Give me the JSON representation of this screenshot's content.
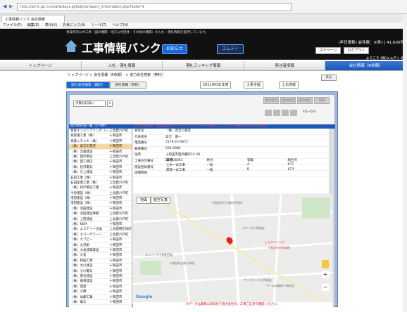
{
  "browser": {
    "url": "http://ad.fc.jp/ a.smartedays.jp/koji/company_information.php?data=1",
    "tab_title": "工事情報バンク 会社検索",
    "menu": [
      "ファイル(F)",
      "編集(E)",
      "表示(V)",
      "お気に入り(A)",
      "ツール(T)",
      "ヘルプ(H)"
    ]
  },
  "header": {
    "notice": "青森県内公共工事（国の機関・地方公共団体・その他の機関）の入札・落札情報を提供しています。",
    "logo": "工事情報バンク",
    "news_button": "お知らせ",
    "edy_button": "エムディ",
    "credit": "(年日更新) 会件数：(0件) | 41,605件",
    "mypage_button": "マイページ",
    "logout_button": "ログアウト",
    "welcome": "ようこそ (株)エムディ 様"
  },
  "nav": {
    "items": [
      "トップページ",
      "入札・落札情報",
      "落札ランキング情報",
      "発注者情報",
      "会社情報（R依頼）"
    ]
  },
  "breadcrumb": "トップページ > 会社情報（R依頼） > 協力会社検索（無料）",
  "subtabs": [
    "協力会社検索（無料）",
    "会社情報（有料）"
  ],
  "filters": {
    "year": "2021(R03)年度",
    "category": "工事全般",
    "region": "上北地域",
    "back": "戻る"
  },
  "list_panel": {
    "sort": "点数対応高い",
    "header": "協力会社名一覧（279件）",
    "buttons": [
      "協力会社",
      "協力会社",
      "協力会社",
      "印刷"
    ],
    "page_text": "4/1~5/4",
    "rows": [
      {
        "name": "青森エンジニアリング（一",
        "area": "上北郡六戸町"
      },
      {
        "name": "青森電工業（株）",
        "area": "十和田市"
      },
      {
        "name": "青森ニチレキ（株）",
        "area": "十和田市"
      },
      {
        "name": "（株）高吉工務店",
        "area": "十和田市"
      },
      {
        "name": "（株）吉田建設",
        "area": "十和田市"
      },
      {
        "name": "（株）西戸電気",
        "area": "上北郡六戸町"
      },
      {
        "name": "（株）西工務店",
        "area": "十和田市"
      },
      {
        "name": "（株）岩沢電気",
        "area": "十和田市"
      },
      {
        "name": "（株）久上建設",
        "area": "十和田市"
      },
      {
        "name": "石田工業（株）",
        "area": "十和田市"
      },
      {
        "name": "石田産業工業（株）",
        "area": "上北郡六戸町"
      },
      {
        "name": "（株）新戸電気工業",
        "area": "十和田市"
      },
      {
        "name": "今泉建設（株）",
        "area": "上北郡六戸町"
      },
      {
        "name": "漆田建設（株）",
        "area": "十和田市"
      },
      {
        "name": "漆田建設（株）",
        "area": "十和田市"
      },
      {
        "name": "（株）漆田建設",
        "area": "十和田市"
      },
      {
        "name": "（株）漆田建設事務",
        "area": "上北郡七戸町"
      },
      {
        "name": "（株）上田建設",
        "area": "上北郡六戸町"
      },
      {
        "name": "（株）NEM",
        "area": "十和田市"
      },
      {
        "name": "（株）エステイ一企画",
        "area": "上北郡野辺地町"
      },
      {
        "name": "（株）エバーグリーン",
        "area": "上北郡六戸町"
      },
      {
        "name": "（株）エブビー",
        "area": "十和田市"
      },
      {
        "name": "（株）大沢組",
        "area": "十和田市"
      },
      {
        "name": "（株）大倉建築建設",
        "area": "十和田市"
      },
      {
        "name": "（株）大島",
        "area": "十和田市"
      },
      {
        "name": "（株）和田工業",
        "area": "十和田市"
      },
      {
        "name": "（株）大川建設",
        "area": "十和田市"
      },
      {
        "name": "（株）小川電気",
        "area": "十和田市"
      },
      {
        "name": "（株）落合建設",
        "area": "十和田市"
      },
      {
        "name": "（株）尾崎建設",
        "area": "十和田市"
      },
      {
        "name": "（株）開発",
        "area": "十和田市"
      },
      {
        "name": "（株）小野",
        "area": "十和田市"
      },
      {
        "name": "（株）加藤工業",
        "area": "十和田市"
      },
      {
        "name": "（株）蛸工",
        "area": "十和田市"
      }
    ]
  },
  "detail": {
    "warning": "協力会社情報　※直近落札ポータルサイトのデータを使用しています。先般5年分5月22日時点",
    "fields": [
      {
        "k": "会社名",
        "v": "（株）高吉工務店"
      },
      {
        "k": "代表者名",
        "v": "高吉　健一"
      },
      {
        "k": "電話番号",
        "v": "0176-23-4672"
      },
      {
        "k": "郵便番号",
        "v": "034-0084"
      },
      {
        "k": "住所",
        "v": "十和田市西四番町14-28"
      },
      {
        "k": "工事許可番号",
        "v": "02-008361"
      },
      {
        "k": "施設登録番号",
        "v": ""
      },
      {
        "k": "詳細情報",
        "v": ""
      }
    ],
    "works_header": [
      "業種",
      "格付",
      "等級",
      "総合点"
    ],
    "works": [
      [
        "土木一式工事",
        "一般",
        "A",
        "677"
      ],
      [
        "建築一式工事",
        "一般",
        "B",
        "673"
      ]
    ]
  },
  "map": {
    "tab_map": "地図",
    "tab_satellite": "航空写真",
    "labels": [
      "十和田市立十和田中学校",
      "パワーズ十和田店",
      "しんクリニック",
      "十和田市中央病院",
      "十和田市立南小学校",
      "ユニバース十和田西店",
      "Google",
      "ケーズデンキ十和田店",
      "ゲーム倶楽部十和田店"
    ],
    "zoom_in": "+",
    "zoom_out": "−"
  },
  "footer": "※データは最新公表日付で協力会社の、工事ご自身で確認ください。"
}
